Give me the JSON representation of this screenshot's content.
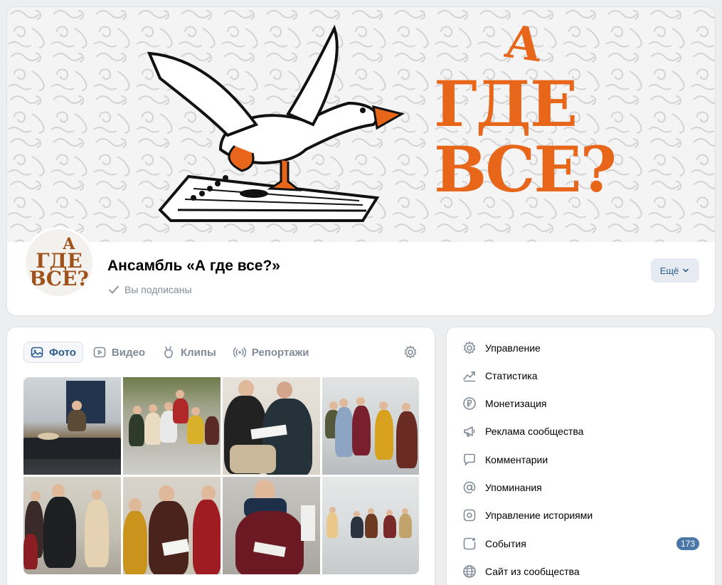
{
  "cover": {
    "title_line1": "А",
    "title_line2": "ГДЕ",
    "title_line3": "ВСЕ?",
    "accent_color": "#e8661a"
  },
  "avatar": {
    "line1": "А",
    "line2": "ГДЕ",
    "line3": "ВСЕ?"
  },
  "group": {
    "name": "Ансамбль «А где все?»",
    "status": "Вы подписаны",
    "more_label": "Ещё"
  },
  "media": {
    "tabs": [
      {
        "label": "Фото",
        "icon": "image-icon",
        "active": true
      },
      {
        "label": "Видео",
        "icon": "play-icon",
        "active": false
      },
      {
        "label": "Клипы",
        "icon": "clips-icon",
        "active": false
      },
      {
        "label": "Репортажи",
        "icon": "broadcast-icon",
        "active": false
      }
    ]
  },
  "menu": {
    "items": [
      {
        "label": "Управление",
        "icon": "gear-icon"
      },
      {
        "label": "Статистика",
        "icon": "chart-icon"
      },
      {
        "label": "Монетизация",
        "icon": "ruble-icon"
      },
      {
        "label": "Реклама сообщества",
        "icon": "megaphone-icon"
      },
      {
        "label": "Комментарии",
        "icon": "comment-icon"
      },
      {
        "label": "Упоминания",
        "icon": "at-icon"
      },
      {
        "label": "Управление историями",
        "icon": "stories-icon"
      },
      {
        "label": "События",
        "icon": "events-icon",
        "badge": "173"
      },
      {
        "label": "Сайт из сообщества",
        "icon": "globe-icon"
      }
    ]
  },
  "colors": {
    "link": "#2c5d8e",
    "secondary_text": "#818c99",
    "badge": "#4a76a8",
    "background": "#edeef0"
  }
}
